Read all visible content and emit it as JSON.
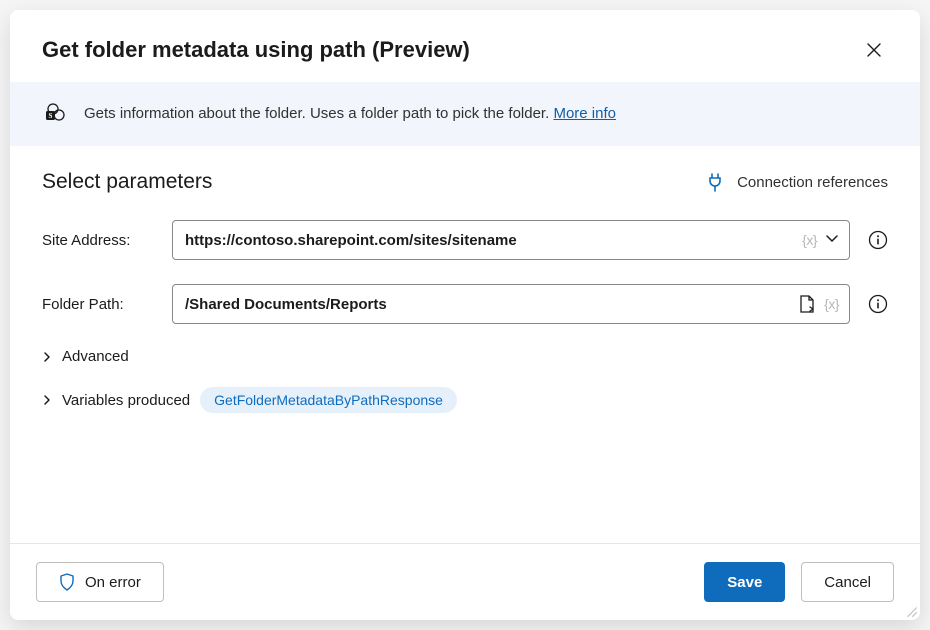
{
  "header": {
    "title": "Get folder metadata using path (Preview)"
  },
  "banner": {
    "text": "Gets information about the folder. Uses a folder path to pick the folder. ",
    "link_label": "More info"
  },
  "section": {
    "title": "Select parameters",
    "connection_references_label": "Connection references"
  },
  "params": {
    "site_address": {
      "label": "Site Address:",
      "value": "https://contoso.sharepoint.com/sites/sitename"
    },
    "folder_path": {
      "label": "Folder Path:",
      "value": "/Shared Documents/Reports"
    }
  },
  "fx_token": "{x}",
  "expanders": {
    "advanced_label": "Advanced",
    "variables_label": "Variables produced",
    "variable_chip": "GetFolderMetadataByPathResponse"
  },
  "footer": {
    "on_error_label": "On error",
    "save_label": "Save",
    "cancel_label": "Cancel"
  }
}
